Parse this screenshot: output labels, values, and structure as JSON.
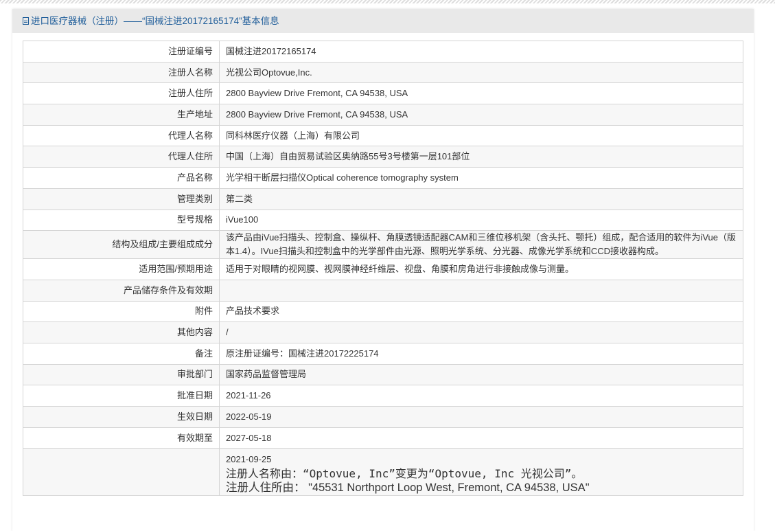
{
  "header": {
    "title": "进口医疗器械（注册）——“国械注进20172165174”基本信息"
  },
  "rows": [
    {
      "label": "注册证编号",
      "value": "国械注进20172165174"
    },
    {
      "label": "注册人名称",
      "value": "光视公司Optovue,Inc."
    },
    {
      "label": "注册人住所",
      "value": "2800 Bayview Drive Fremont, CA 94538, USA"
    },
    {
      "label": "生产地址",
      "value": "2800 Bayview Drive Fremont, CA 94538, USA"
    },
    {
      "label": "代理人名称",
      "value": "同科林医疗仪器（上海）有限公司"
    },
    {
      "label": "代理人住所",
      "value": "中国（上海）自由贸易试验区奥纳路55号3号楼第一层101部位"
    },
    {
      "label": "产品名称",
      "value": "光学相干断层扫描仪Optical coherence tomography system"
    },
    {
      "label": "管理类别",
      "value": "第二类"
    },
    {
      "label": "型号规格",
      "value": "iVue100"
    },
    {
      "label": "结构及组成/主要组成成分",
      "value": "该产品由iVue扫描头、控制盒、操纵杆、角膜透镜适配器CAM和三维位移机架（含头托、颚托）组成，配合适用的软件为iVue（版本1.4）。IVue扫描头和控制盒中的光学部件由光源、照明光学系统、分光器、成像光学系统和CCD接收器构成。"
    },
    {
      "label": "适用范围/预期用途",
      "value": "适用于对眼睛的视网膜、视网膜神经纤维层、视盘、角膜和房角进行非接触成像与测量。"
    },
    {
      "label": "产品储存条件及有效期",
      "value": ""
    },
    {
      "label": "附件",
      "value": "产品技术要求"
    },
    {
      "label": "其他内容",
      "value": "/"
    },
    {
      "label": "备注",
      "value": "原注册证编号：国械注进20172225174"
    },
    {
      "label": "审批部门",
      "value": "国家药品监督管理局"
    },
    {
      "label": "批准日期",
      "value": "2021-11-26"
    },
    {
      "label": "生效日期",
      "value": "2022-05-19"
    },
    {
      "label": "有效期至",
      "value": "2027-05-18"
    }
  ],
  "changes": {
    "date": "2021-09-25",
    "line1": "注册人名称由：“Optovue, Inc”变更为“Optovue, Inc 光视公司”。",
    "line2": "注册人住所由： \"45531 Northport Loop West, Fremont, CA 94538, USA\""
  }
}
